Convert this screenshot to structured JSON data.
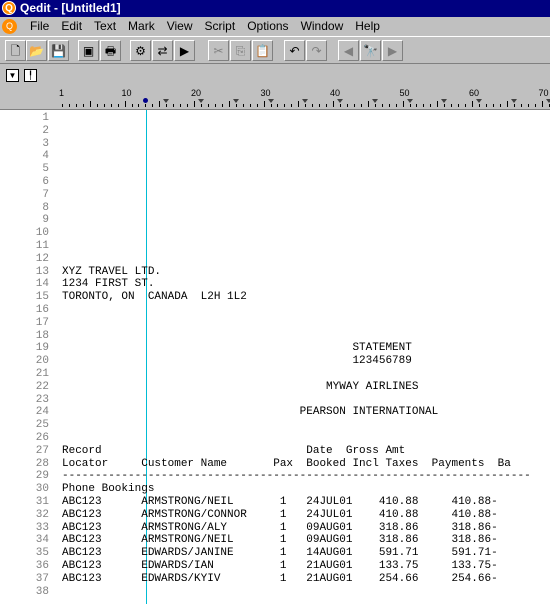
{
  "window": {
    "title": "Qedit - [Untitled1]"
  },
  "menu": [
    "File",
    "Edit",
    "Text",
    "Mark",
    "View",
    "Script",
    "Options",
    "Window",
    "Help"
  ],
  "toolbar": [
    {
      "name": "new-icon",
      "glyph": "🗋",
      "disabled": false
    },
    {
      "name": "open-icon",
      "glyph": "📂",
      "disabled": false
    },
    {
      "name": "save-icon",
      "glyph": "💾",
      "disabled": false
    },
    {
      "name": "save-all-icon",
      "glyph": "▣",
      "disabled": false
    },
    {
      "name": "print-icon",
      "glyph": "🖶",
      "disabled": false
    },
    {
      "name": "compile-icon",
      "glyph": "⚙",
      "disabled": false
    },
    {
      "name": "compare-icon",
      "glyph": "⇄",
      "disabled": false
    },
    {
      "name": "run-icon",
      "glyph": "▶",
      "disabled": false
    },
    {
      "name": "cut-icon",
      "glyph": "✂",
      "disabled": true
    },
    {
      "name": "copy-icon",
      "glyph": "⎘",
      "disabled": true
    },
    {
      "name": "paste-icon",
      "glyph": "📋",
      "disabled": false
    },
    {
      "name": "undo-icon",
      "glyph": "↶",
      "disabled": false
    },
    {
      "name": "redo-icon",
      "glyph": "↷",
      "disabled": true
    },
    {
      "name": "find-previous-icon",
      "glyph": "◀",
      "disabled": true
    },
    {
      "name": "find-icon",
      "glyph": "🔭",
      "disabled": false
    },
    {
      "name": "find-next-icon",
      "glyph": "▶",
      "disabled": true
    }
  ],
  "ruler_labels": [
    "1",
    "10",
    "20",
    "30",
    "40",
    "50",
    "60",
    "70"
  ],
  "lines": [
    "",
    "",
    "",
    "",
    "",
    "",
    "",
    "",
    "",
    "",
    "",
    "",
    "XYZ TRAVEL LTD.",
    "1234 FIRST ST.",
    "TORONTO, ON  CANADA  L2H 1L2",
    "",
    "",
    "",
    "                                            STATEMENT",
    "                                            123456789",
    "",
    "                                        MYWAY AIRLINES",
    "",
    "                                    PEARSON INTERNATIONAL",
    "",
    "",
    "Record                               Date  Gross Amt",
    "Locator     Customer Name       Pax  Booked Incl Taxes  Payments  Ba",
    "-----------------------------------------------------------------------",
    "Phone Bookings",
    "ABC123      ARMSTRONG/NEIL       1   24JUL01    410.88     410.88-",
    "ABC123      ARMSTRONG/CONNOR     1   24JUL01    410.88     410.88-",
    "ABC123      ARMSTRONG/ALY        1   09AUG01    318.86     318.86-",
    "ABC123      ARMSTRONG/NEIL       1   09AUG01    318.86     318.86-",
    "ABC123      EDWARDS/JANINE       1   14AUG01    591.71     591.71-",
    "ABC123      EDWARDS/IAN          1   21AUG01    133.75     133.75-",
    "ABC123      EDWARDS/KYIV         1   21AUG01    254.66     254.66-",
    ""
  ]
}
